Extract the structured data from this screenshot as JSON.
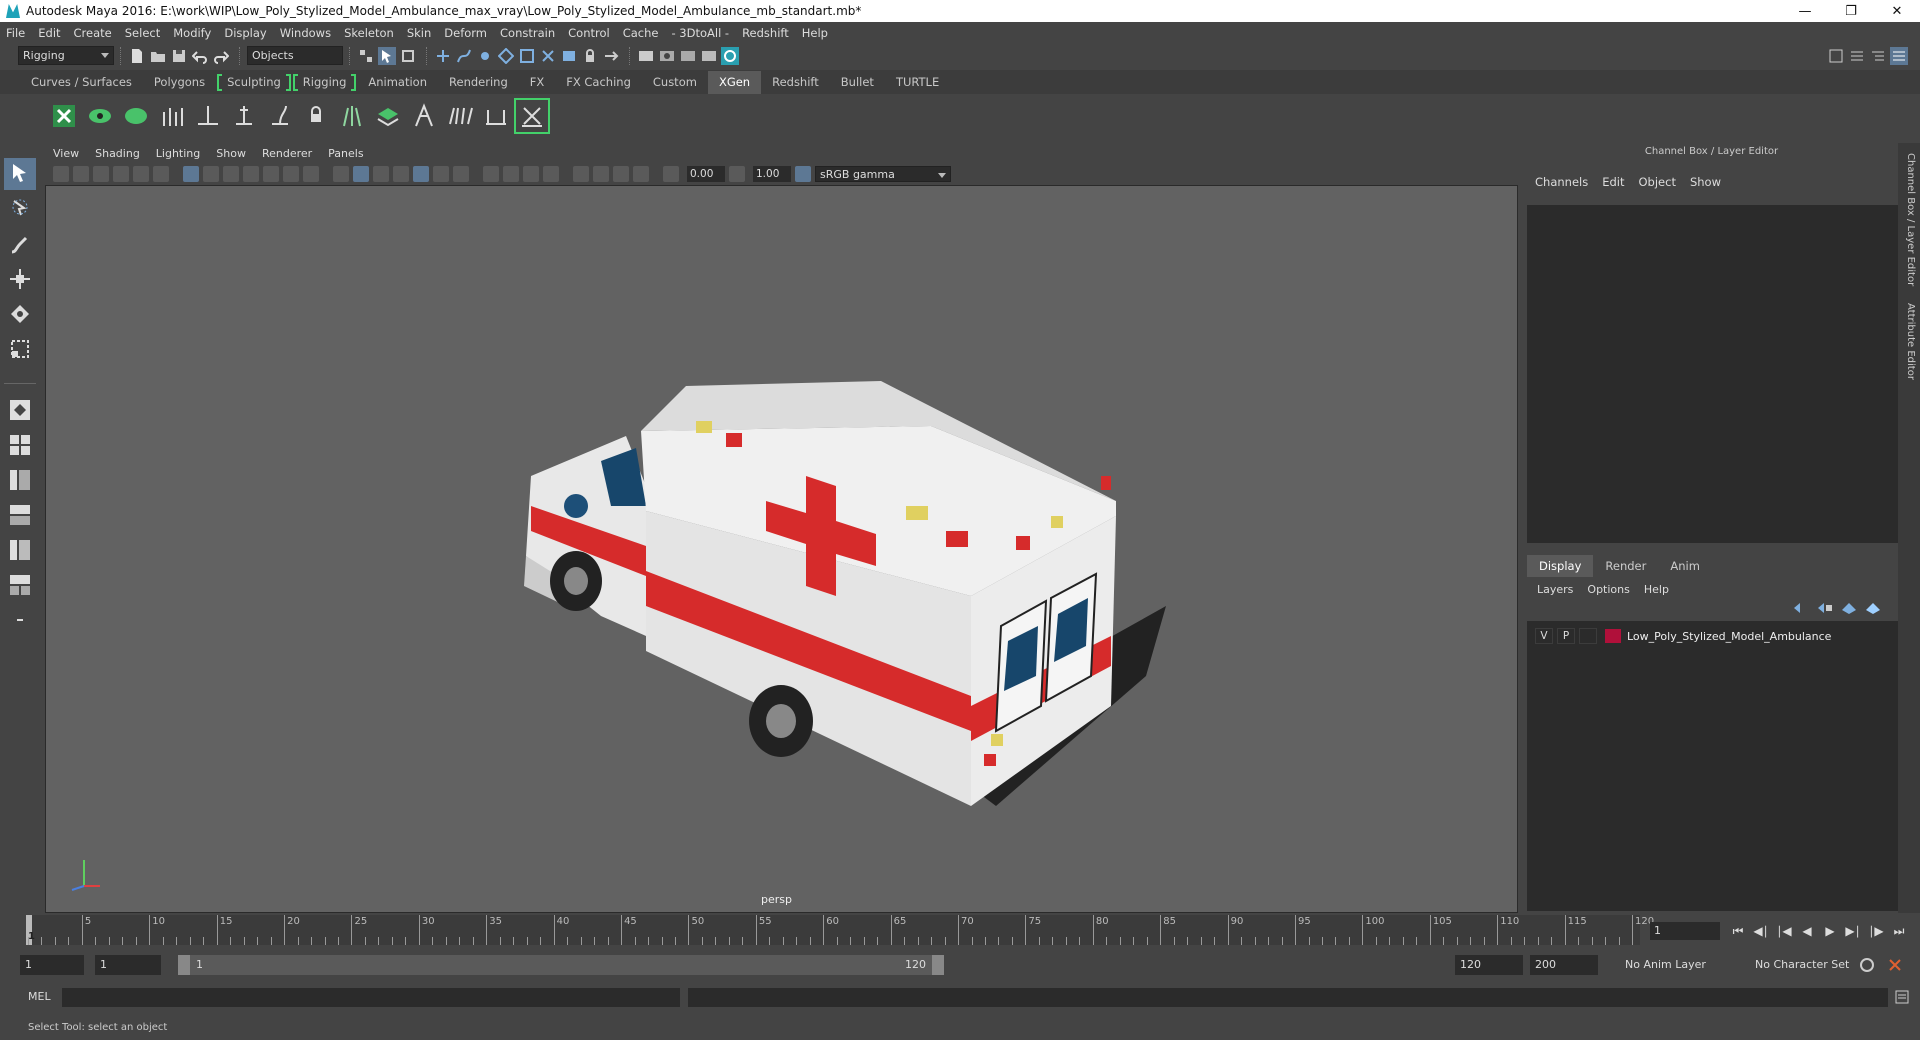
{
  "window": {
    "title": "Autodesk Maya 2016: E:\\work\\WIP\\Low_Poly_Stylized_Model_Ambulance_max_vray\\Low_Poly_Stylized_Model_Ambulance_mb_standart.mb*"
  },
  "menubar": [
    "File",
    "Edit",
    "Create",
    "Select",
    "Modify",
    "Display",
    "Windows",
    "Skeleton",
    "Skin",
    "Deform",
    "Constrain",
    "Control",
    "Cache",
    "- 3DtoAll -",
    "Redshift",
    "Help"
  ],
  "statusline": {
    "menuset": "Rigging",
    "selection_mode": "Objects"
  },
  "shelf_tabs": [
    {
      "label": "Curves / Surfaces"
    },
    {
      "label": "Polygons"
    },
    {
      "label": "Sculpting"
    },
    {
      "label": "Rigging"
    },
    {
      "label": "Animation"
    },
    {
      "label": "Rendering"
    },
    {
      "label": "FX"
    },
    {
      "label": "FX Caching"
    },
    {
      "label": "Custom"
    },
    {
      "label": "XGen"
    },
    {
      "label": "Redshift"
    },
    {
      "label": "Bullet"
    },
    {
      "label": "TURTLE"
    }
  ],
  "active_shelf_tab": "XGen",
  "viewport": {
    "menu": [
      "View",
      "Shading",
      "Lighting",
      "Show",
      "Renderer",
      "Panels"
    ],
    "exposure": "0.00",
    "gamma": "1.00",
    "color_space": "sRGB gamma",
    "camera": "persp"
  },
  "channel_box": {
    "title": "Channel Box / Layer Editor",
    "menu": [
      "Channels",
      "Edit",
      "Object",
      "Show"
    ]
  },
  "layer_editor": {
    "tabs": [
      "Display",
      "Render",
      "Anim"
    ],
    "active_tab": "Display",
    "menu": [
      "Layers",
      "Options",
      "Help"
    ],
    "layers": [
      {
        "v": "V",
        "p": "P",
        "name": "Low_Poly_Stylized_Model_Ambulance",
        "color": "#b0103a"
      }
    ]
  },
  "side_tabs": [
    "Channel Box / Layer Editor",
    "Attribute Editor"
  ],
  "timeline": {
    "tick_labels": [
      "5",
      "10",
      "15",
      "20",
      "25",
      "30",
      "35",
      "40",
      "45",
      "50",
      "55",
      "60",
      "65",
      "70",
      "75",
      "80",
      "85",
      "90",
      "95",
      "100",
      "105",
      "110",
      "115",
      "120"
    ],
    "playhead_frame": "1",
    "current_frame": "1"
  },
  "range": {
    "start": "1",
    "playback_start": "1",
    "slider_start": "1",
    "slider_end": "120",
    "playback_end": "120",
    "end": "200",
    "anim_layer": "No Anim Layer",
    "character_set": "No Character Set"
  },
  "command_line": {
    "label": "MEL"
  },
  "help_line": "Select Tool: select an object",
  "colors": {
    "accent": "#5d7894",
    "xgen_green": "#43d16a",
    "viewport_bg": "#626262",
    "layer_color": "#b0103a"
  }
}
